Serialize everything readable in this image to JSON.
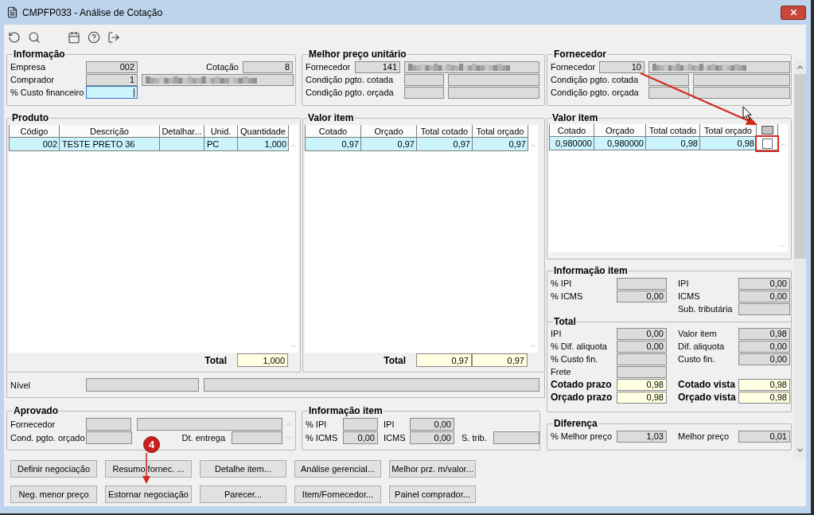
{
  "window": {
    "title": "CMPFP033 - Análise de Cotação"
  },
  "informacao": {
    "title": "Informação",
    "empresa": {
      "label": "Empresa",
      "value": "002"
    },
    "cotacao": {
      "label": "Cotação",
      "value": "8"
    },
    "comprador": {
      "label": "Comprador",
      "value": "1",
      "blurred": true
    },
    "custo_financeiro": {
      "label": "% Custo financeiro",
      "focused": true
    }
  },
  "melhor_preco": {
    "title": "Melhor preço unitário",
    "fornecedor": {
      "label": "Fornecedor",
      "value": "141",
      "blurred": true
    },
    "conditions": [
      {
        "label": "Condição pgto. cotada"
      },
      {
        "label": "Condição pgto. orçada"
      }
    ]
  },
  "fornecedor": {
    "title": "Fornecedor",
    "fornecedor": {
      "label": "Fornecedor",
      "value": "10",
      "blurred": true
    },
    "conditions": [
      {
        "label": "Condição pgto. cotada"
      },
      {
        "label": "Condição pgto. orçada"
      }
    ]
  },
  "produto": {
    "title": "Produto",
    "columns": [
      "Código",
      "Descrição",
      "Detalhar...",
      "Unid.",
      "Quantidade"
    ],
    "rows": [
      {
        "selected": true,
        "cells": [
          "002",
          "TESTE PRETO 36",
          null,
          "PC",
          "1,000"
        ]
      }
    ],
    "total_label": "Total",
    "totals": [
      "1,000"
    ]
  },
  "valor_item": {
    "title": "Valor item",
    "columns": [
      "Cotado",
      "Orçado",
      "Total cotado",
      "Total orçado"
    ],
    "rows": [
      {
        "selected": true,
        "cells": [
          "0,97",
          "0,97",
          "0,97",
          "0,97"
        ]
      }
    ],
    "total_label": "Total",
    "totals": [
      "0,97",
      "0,97"
    ]
  },
  "fornecedor_valor_item": {
    "title": "Valor item",
    "columns": [
      "Cotado",
      "Orçado",
      "Total cotado",
      "Total orçado"
    ],
    "rows": [
      {
        "selected": true,
        "checked": false,
        "cells": [
          "0,980000",
          "0,980000",
          "0,98",
          "0,98"
        ]
      }
    ]
  },
  "nivel": {
    "label": "Nível"
  },
  "aprovado": {
    "title": "Aprovado",
    "fornecedor_label": "Fornecedor",
    "cond_label": "Cond. pgto. orçado",
    "dt_entrega_label": "Dt. entrega"
  },
  "informacao_item_bottom": {
    "title": "Informação item",
    "pct_ipi": {
      "label": "% IPI"
    },
    "ipi": {
      "label": "IPI",
      "value": "0,00"
    },
    "pct_icms": {
      "label": "% ICMS",
      "value": "0,00"
    },
    "icms": {
      "label": "ICMS",
      "value": "0,00"
    },
    "s_trib": {
      "label": "S. trib."
    }
  },
  "informacao_item": {
    "title": "Informação item",
    "rows": [
      {
        "kind": "plain",
        "left": {
          "label": "% IPI"
        },
        "right": {
          "label": "IPI",
          "value": "0,00"
        }
      },
      {
        "kind": "plain",
        "left": {
          "label": "% ICMS",
          "value": "0,00"
        },
        "right": {
          "label": "ICMS",
          "value": "0,00"
        }
      },
      {
        "kind": "plain",
        "right": {
          "label": "Sub. tributária"
        }
      }
    ]
  },
  "total": {
    "title": "Total",
    "rows": [
      {
        "kind": "plain",
        "left": {
          "label": "IPI",
          "value": "0,00"
        },
        "right": {
          "label": "Valor item",
          "value": "0,98"
        }
      },
      {
        "kind": "plain",
        "left": {
          "label": "% Dif. aliquota",
          "value": "0,00"
        },
        "right": {
          "label": "Dif. aliquota",
          "value": "0,00"
        }
      },
      {
        "kind": "plain",
        "left": {
          "label": "% Custo fin."
        },
        "right": {
          "label": "Custo fin.",
          "value": "0,00"
        }
      },
      {
        "kind": "plain",
        "left": {
          "label": "Frete"
        }
      },
      {
        "kind": "highlight",
        "left": {
          "label": "Cotado prazo",
          "value": "0,98"
        },
        "right": {
          "label": "Cotado vista",
          "value": "0,98"
        }
      },
      {
        "kind": "highlight",
        "left": {
          "label": "Orçado prazo",
          "value": "0,98"
        },
        "right": {
          "label": "Orçado vista",
          "value": "0,98"
        }
      }
    ]
  },
  "diferenca": {
    "title": "Diferença",
    "rows": [
      {
        "kind": "plain",
        "left": {
          "label": "% Melhor preço",
          "value": "1,03"
        },
        "right": {
          "label": "Melhor preço",
          "value": "0,01"
        }
      }
    ]
  },
  "buttons": [
    [
      "Definir negociação",
      "Resumo fornec. ...",
      "Detalhe item...",
      "Análise gerencial...",
      "Melhor prz. m/valor..."
    ],
    [
      "Neg. menor preço",
      "Estornar negociação",
      "Parecer...",
      "Item/Fornecedor...",
      "Painel comprador..."
    ]
  ],
  "annotation": {
    "step": "4"
  }
}
